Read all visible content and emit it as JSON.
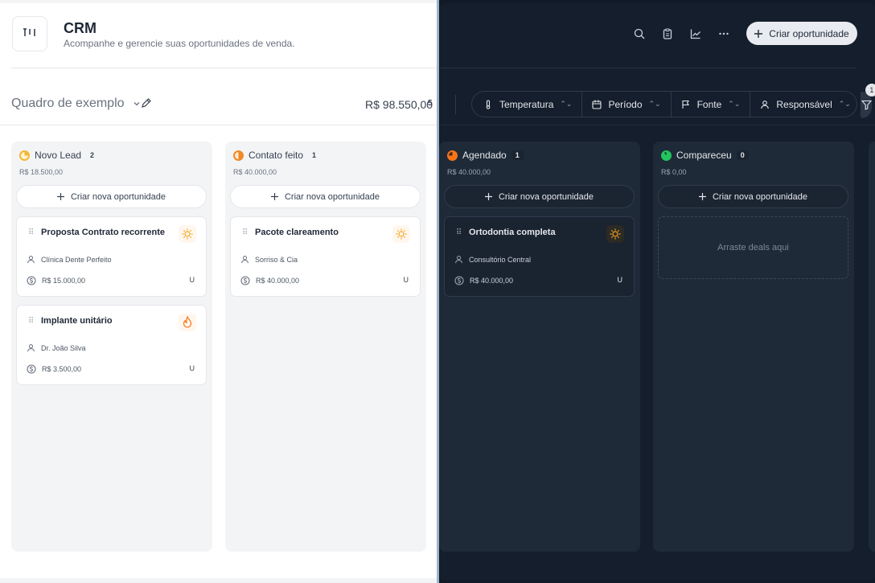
{
  "header": {
    "title": "CRM",
    "subtitle": "Acompanhe e gerencie suas oportunidades de venda.",
    "create_label": "Criar oportunidade"
  },
  "toolbar": {
    "board_name": "Quadro de exemplo",
    "total_value": "R$ 98.550,00",
    "total_count": "5",
    "filters": [
      {
        "label": "Temperatura",
        "icon": "thermometer-icon"
      },
      {
        "label": "Período",
        "icon": "calendar-icon"
      },
      {
        "label": "Fonte",
        "icon": "flag-icon"
      },
      {
        "label": "Responsável",
        "icon": "user-icon"
      }
    ],
    "filter_badge": "1"
  },
  "columns": [
    {
      "title": "Novo Lead",
      "count": "2",
      "total": "R$ 18.500,00",
      "color": "#f5b631",
      "add_label": "Criar nova oportunidade",
      "cards": [
        {
          "title": "Proposta Contrato recorrente",
          "contact": "Clínica Dente Perfeito",
          "value": "R$ 15.000,00",
          "owner": "U",
          "temperature": "sun-icon"
        },
        {
          "title": "Implante unitário",
          "contact": "Dr. João Silva",
          "value": "R$ 3.500,00",
          "owner": "U",
          "temperature": "flame-icon"
        }
      ]
    },
    {
      "title": "Contato feito",
      "count": "1",
      "total": "R$ 40.000,00",
      "color": "#f08a24",
      "add_label": "Criar nova oportunidade",
      "cards": [
        {
          "title": "Pacote clareamento",
          "contact": "Sorriso & Cia",
          "value": "R$ 40.000,00",
          "owner": "U",
          "temperature": "sun-icon"
        }
      ]
    },
    {
      "title": "Agendado",
      "count": "1",
      "total": "R$ 40.000,00",
      "color": "#f97316",
      "add_label": "Criar nova oportunidade",
      "cards": [
        {
          "title": "Ortodontia completa",
          "contact": "Consultório Central",
          "value": "R$ 40.000,00",
          "owner": "U",
          "temperature": "sun-icon"
        }
      ]
    },
    {
      "title": "Compareceu",
      "count": "0",
      "total": "R$ 0,00",
      "color": "#22c55e",
      "add_label": "Criar nova oportunidade",
      "empty_label": "Arraste deals aqui"
    }
  ]
}
